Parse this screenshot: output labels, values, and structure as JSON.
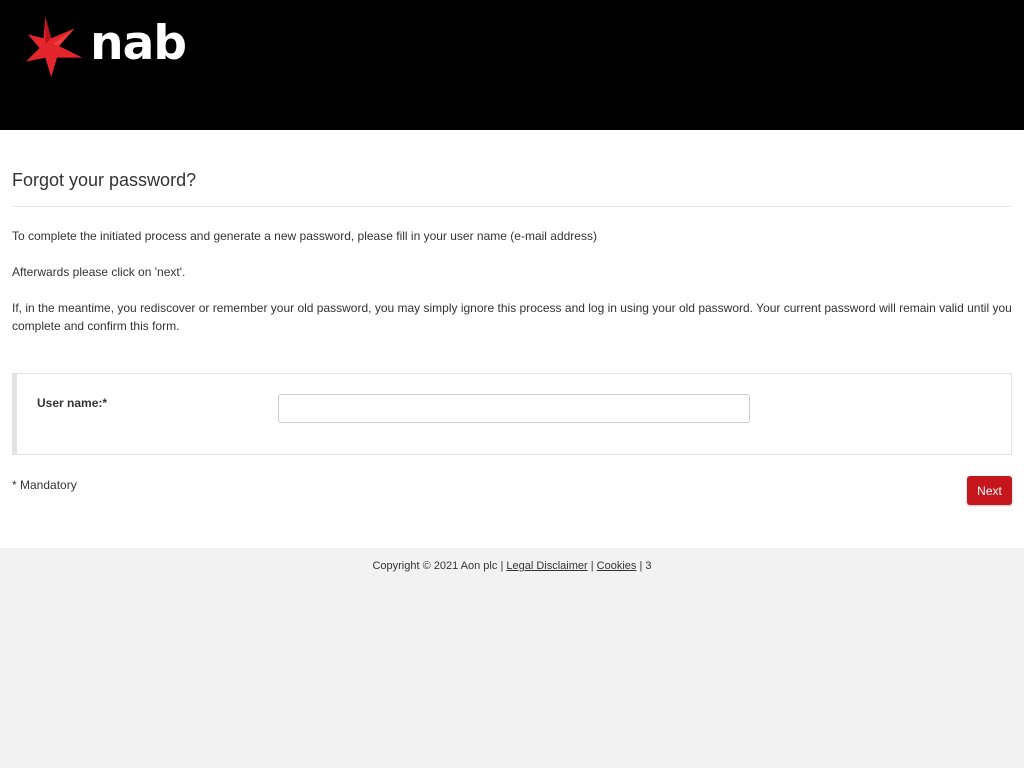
{
  "header": {
    "logo_text": "nab",
    "logo_star_color": "#e4262c",
    "background_color": "#000000"
  },
  "main": {
    "title": "Forgot your password?",
    "paragraphs": [
      "To complete the initiated process and generate a new password, please fill in your user name (e-mail address)",
      "Afterwards please click on 'next'.",
      "If, in the meantime, you rediscover or remember your old password, you may simply ignore this process and log in using your old password. Your current password will remain valid until you complete and confirm this form."
    ],
    "form": {
      "username_label": "User name:*",
      "username_value": "",
      "username_placeholder": ""
    },
    "mandatory_note": "* Mandatory",
    "next_label": "Next",
    "accent_color": "#c4161c"
  },
  "footer": {
    "copyright": "Copyright © 2021 Aon plc",
    "sep1": "|",
    "legal_label": "Legal Disclaimer",
    "sep2": "|",
    "cookies_label": "Cookies",
    "sep3": "|",
    "version": "3"
  }
}
